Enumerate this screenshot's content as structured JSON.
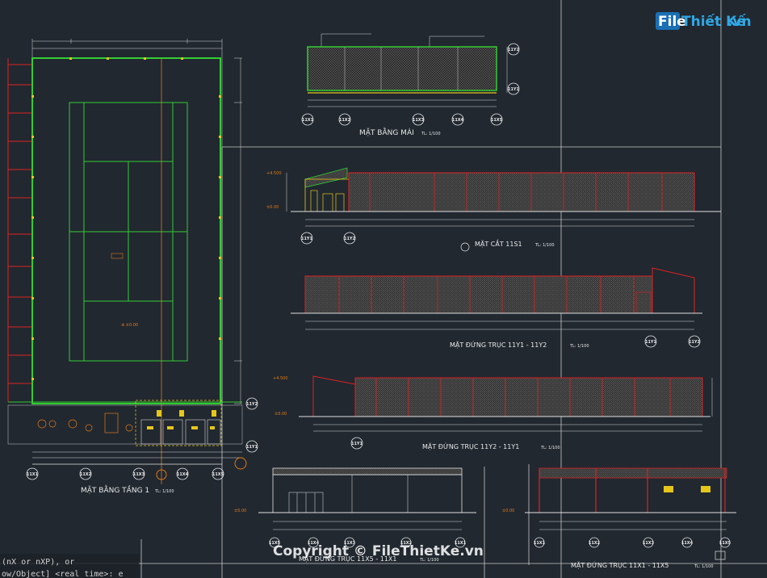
{
  "titles": {
    "roof_plan": "MẶT BẰNG MÁI",
    "roof_plan_scale": "TL: 1/100",
    "section": "MẶT CẮT 11S1",
    "section_scale": "TL: 1/100",
    "elev_y1_y2": "MẶT ĐỨNG TRỤC 11Y1 - 11Y2",
    "elev_y1_y2_scale": "TL: 1/100",
    "elev_y2_y1": "MẶT ĐỨNG TRỤC 11Y2 - 11Y1",
    "elev_y2_y1_scale": "TL: 1/100",
    "elev_x5_x1": "MẶT ĐỨNG TRỤC 11X5 - 11X1",
    "elev_x5_x1_scale": "TL: 1/100",
    "elev_x1_x5": "MẶT ĐỨNG TRỤC 11X1 - 11X5",
    "elev_x1_x5_scale": "TL: 1/100",
    "floor_plan": "MẶT BẰNG TẦNG 1",
    "floor_plan_scale": "TL: 1/100"
  },
  "axes": {
    "floor_x": [
      "11X1",
      "11X2",
      "11X3",
      "11X4",
      "11X5"
    ],
    "floor_y": [
      "11Y2",
      "11Y1"
    ],
    "roof_x": [
      "11X1",
      "11X2",
      "11X3",
      "11X4",
      "11X5"
    ],
    "roof_y": [
      "11Y2",
      "11Y1"
    ],
    "section": [
      "11Y1",
      "11Y2"
    ],
    "elev_y1_y2": [
      "11Y1",
      "11Y2"
    ],
    "elev_y2_y1": [
      "11Y1"
    ],
    "elev_x5_x1": [
      "11X5",
      "11X4",
      "11X3",
      "11X2",
      "11X1"
    ],
    "elev_x1_x5": [
      "11X1",
      "11X2",
      "11X3",
      "11X4",
      "11X5"
    ]
  },
  "watermark": {
    "logo_part1": "File",
    "logo_part2": "Thiết Kế",
    "logo_part3": ".vn",
    "copyright": "Copyright © FileThietKe.vn"
  },
  "command_line": {
    "line1": "(nX or nXP), or",
    "line2": "ow/Object] <real time>:  e"
  },
  "colors": {
    "background": "#212830",
    "court_green": "#33cc33",
    "wall_red": "#dd2222",
    "roof_yellow": "#e6c619",
    "dim_white": "#e0e0e0",
    "axis_orange": "#e07a16"
  }
}
